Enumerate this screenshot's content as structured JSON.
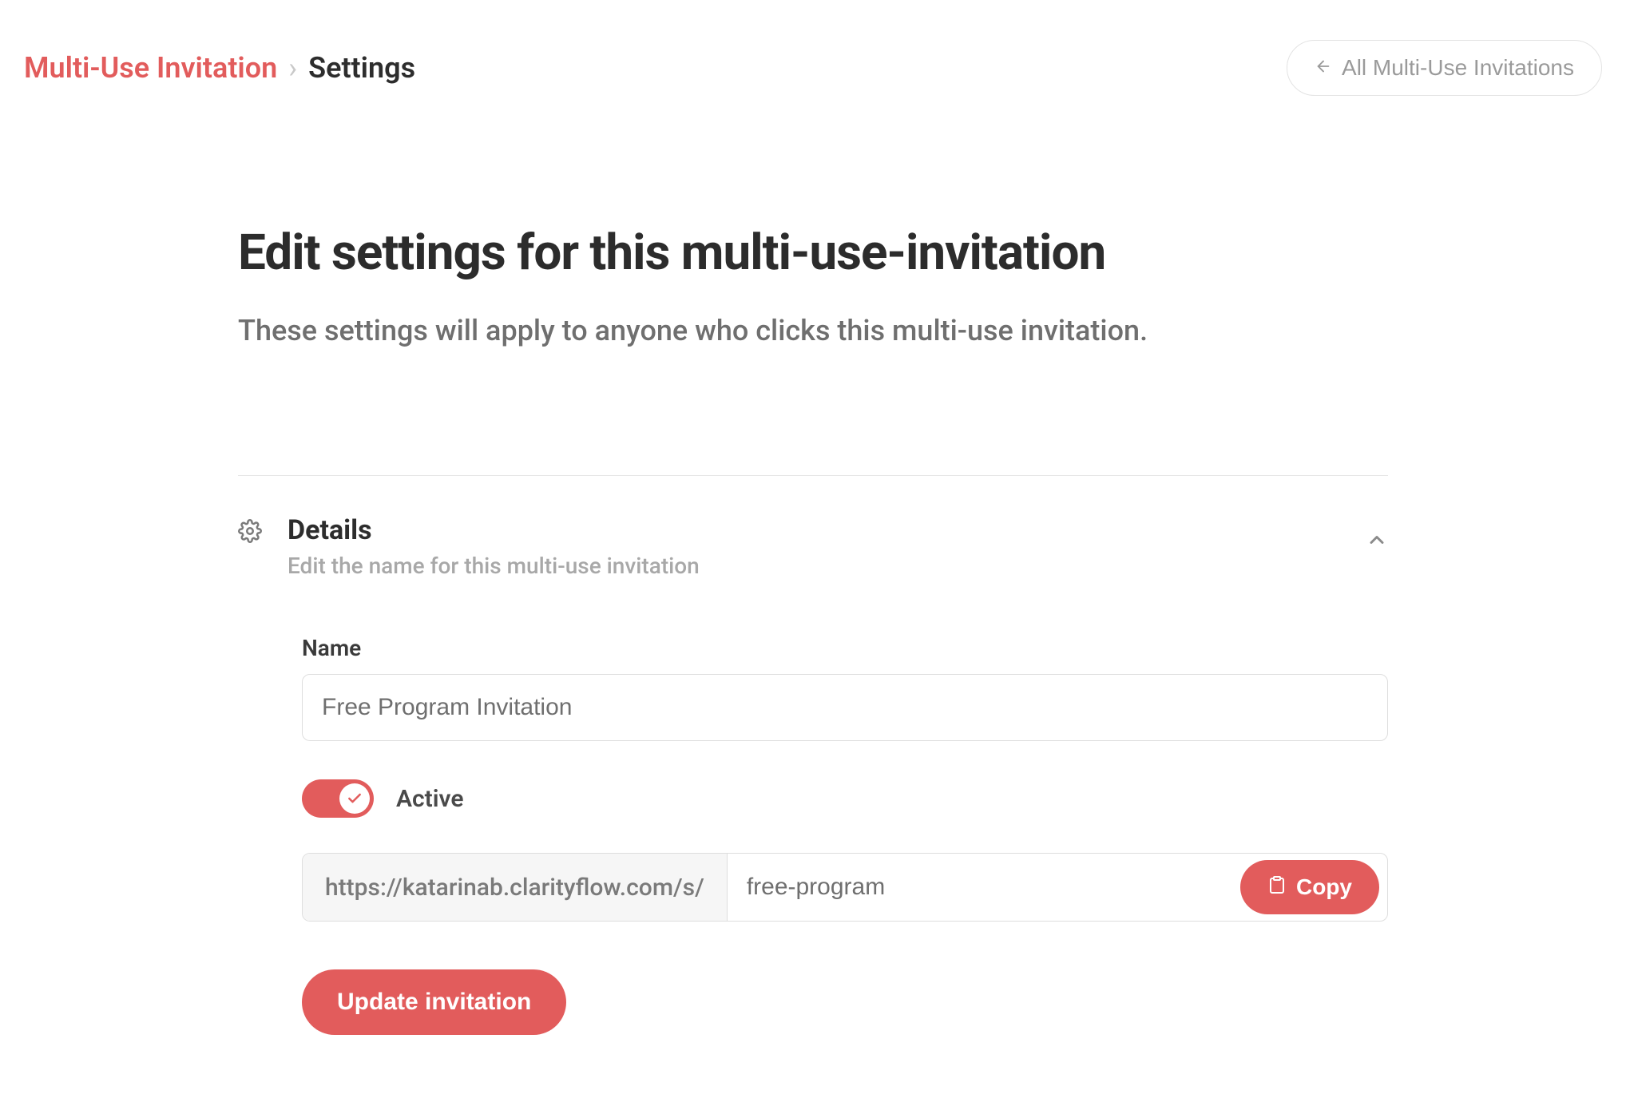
{
  "breadcrumb": {
    "root": "Multi-Use Invitation",
    "current": "Settings"
  },
  "header": {
    "all_invitations_label": "All Multi-Use Invitations"
  },
  "page": {
    "title": "Edit settings for this multi-use-invitation",
    "subtitle": "These settings will apply to anyone who clicks this multi-use invitation."
  },
  "details_section": {
    "title": "Details",
    "description": "Edit the name for this multi-use invitation",
    "name_label": "Name",
    "name_value": "Free Program Invitation",
    "active_label": "Active",
    "active_value": true,
    "url_prefix": "https://katarinab.clarityflow.com/s/",
    "url_slug": "free-program",
    "copy_label": "Copy",
    "update_label": "Update invitation"
  },
  "colors": {
    "accent": "#e25c5c"
  }
}
